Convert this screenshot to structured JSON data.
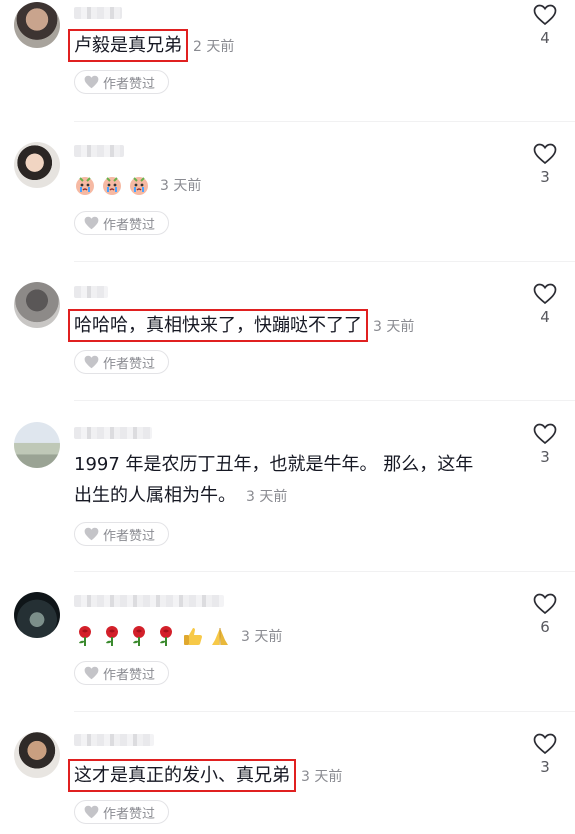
{
  "comments": [
    {
      "text": "卢毅是真兄弟",
      "time": "2 天前",
      "likes": "4",
      "author_pill": "作者赞过",
      "highlighted": true
    },
    {
      "text": "",
      "time": "3 天前",
      "likes": "3",
      "author_pill": "作者赞过",
      "emojis": [
        "crying-face-icon",
        "crying-face-icon",
        "crying-face-icon"
      ]
    },
    {
      "text": "哈哈哈，真相快来了，快蹦哒不了了",
      "time": "3 天前",
      "likes": "4",
      "author_pill": "作者赞过",
      "highlighted": true
    },
    {
      "text_line1": "1997 年是农历丁丑年，也就是牛年。 那么，这年",
      "text_line2": "出生的人属相为牛。",
      "time": "3 天前",
      "likes": "3",
      "author_pill": "作者赞过"
    },
    {
      "text": "",
      "time": "3 天前",
      "likes": "6",
      "author_pill": "作者赞过",
      "emojis": [
        "rose-icon",
        "rose-icon",
        "rose-icon",
        "rose-icon",
        "thumbs-up-icon",
        "praying-hands-icon"
      ]
    },
    {
      "text": "这才是真正的发小、真兄弟",
      "time": "3 天前",
      "likes": "3",
      "author_pill": "作者赞过",
      "highlighted": true
    }
  ],
  "colors": {
    "highlight_box": "#e02020",
    "meta_text": "#8a8b91",
    "main_text": "#161823"
  }
}
